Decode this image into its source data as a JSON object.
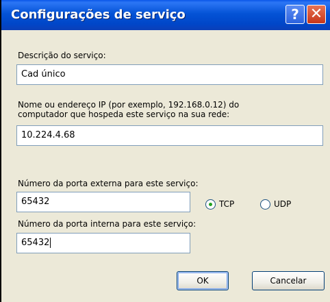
{
  "window": {
    "title": "Configurações de serviço",
    "help_glyph": "?",
    "close_glyph": "✕"
  },
  "description": {
    "label": "Descrição do serviço:",
    "value": "Cad único"
  },
  "host": {
    "label_line1": "Nome ou endereço IP (por exemplo, 192.168.0.12) do",
    "label_line2": "computador que hospeda este serviço na sua rede:",
    "value": "10.224.4.68"
  },
  "external_port": {
    "label": "Número da porta externa para este serviço:",
    "value": "65432"
  },
  "protocol": {
    "options": [
      "TCP",
      "UDP"
    ],
    "selected": "TCP"
  },
  "internal_port": {
    "label": "Número da porta interna para este serviço:",
    "value": "65432"
  },
  "buttons": {
    "ok": "OK",
    "cancel": "Cancelar"
  },
  "colors": {
    "titlebar": "#0453d6",
    "dialog_bg": "#ece9d8",
    "field_border": "#7f9db9",
    "radio_selected": "#21a121"
  },
  "icons": {
    "help": "help-icon",
    "close": "close-icon"
  }
}
